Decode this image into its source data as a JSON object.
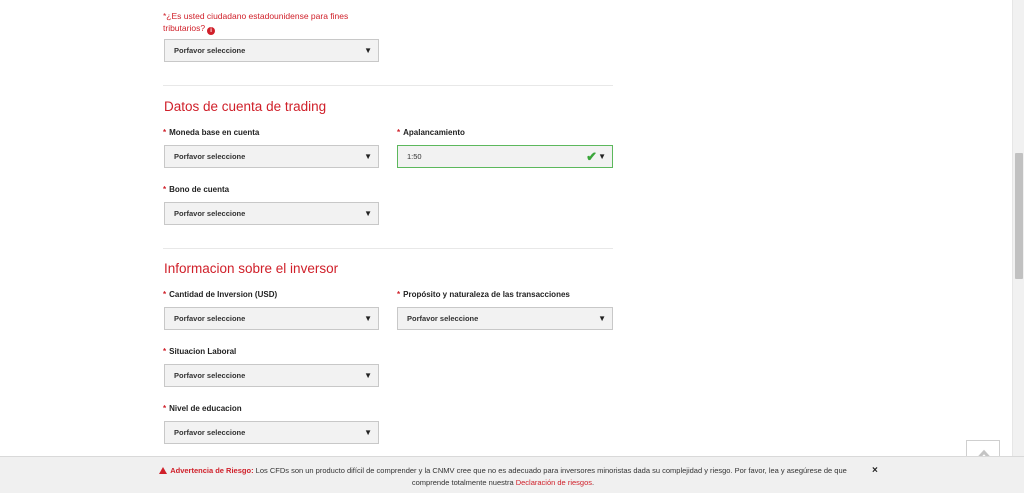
{
  "tax_question": {
    "label": "*¿Es usted ciudadano estadounidense para fines tributarios?",
    "info_icon": "info-icon",
    "value": "Porfavor seleccione"
  },
  "trading_section": {
    "title": "Datos de cuenta de trading",
    "base_currency": {
      "label": "Moneda base en cuenta",
      "value": "Porfavor seleccione"
    },
    "leverage": {
      "label": "Apalancamiento",
      "value": "1:50"
    },
    "bonus": {
      "label": "Bono de cuenta",
      "value": "Porfavor seleccione"
    }
  },
  "investor_section": {
    "title": "Informacion sobre el inversor",
    "investment_amount": {
      "label": "Cantidad de Inversion (USD)",
      "value": "Porfavor seleccione"
    },
    "purpose": {
      "label": "Propósito y naturaleza de las transacciones",
      "value": "Porfavor seleccione"
    },
    "employment": {
      "label": "Situacion Laboral",
      "value": "Porfavor seleccione"
    },
    "education": {
      "label": "Nivel de educacion",
      "value": "Porfavor seleccione"
    }
  },
  "required_mark": "*",
  "risk_bar": {
    "warning_label": "Advertencia de Riesgo:",
    "text": " Los CFDs son un producto difícil de comprender y la CNMV cree que no es adecuado para inversores minoristas dada su complejidad y riesgo. Por favor, lea y asegúrese de que comprende totalmente nuestra ",
    "link_text": "Declaración de riesgos",
    "end": ".",
    "close": "×"
  },
  "colors": {
    "accent": "#d0202a",
    "valid": "#3aa53a"
  }
}
